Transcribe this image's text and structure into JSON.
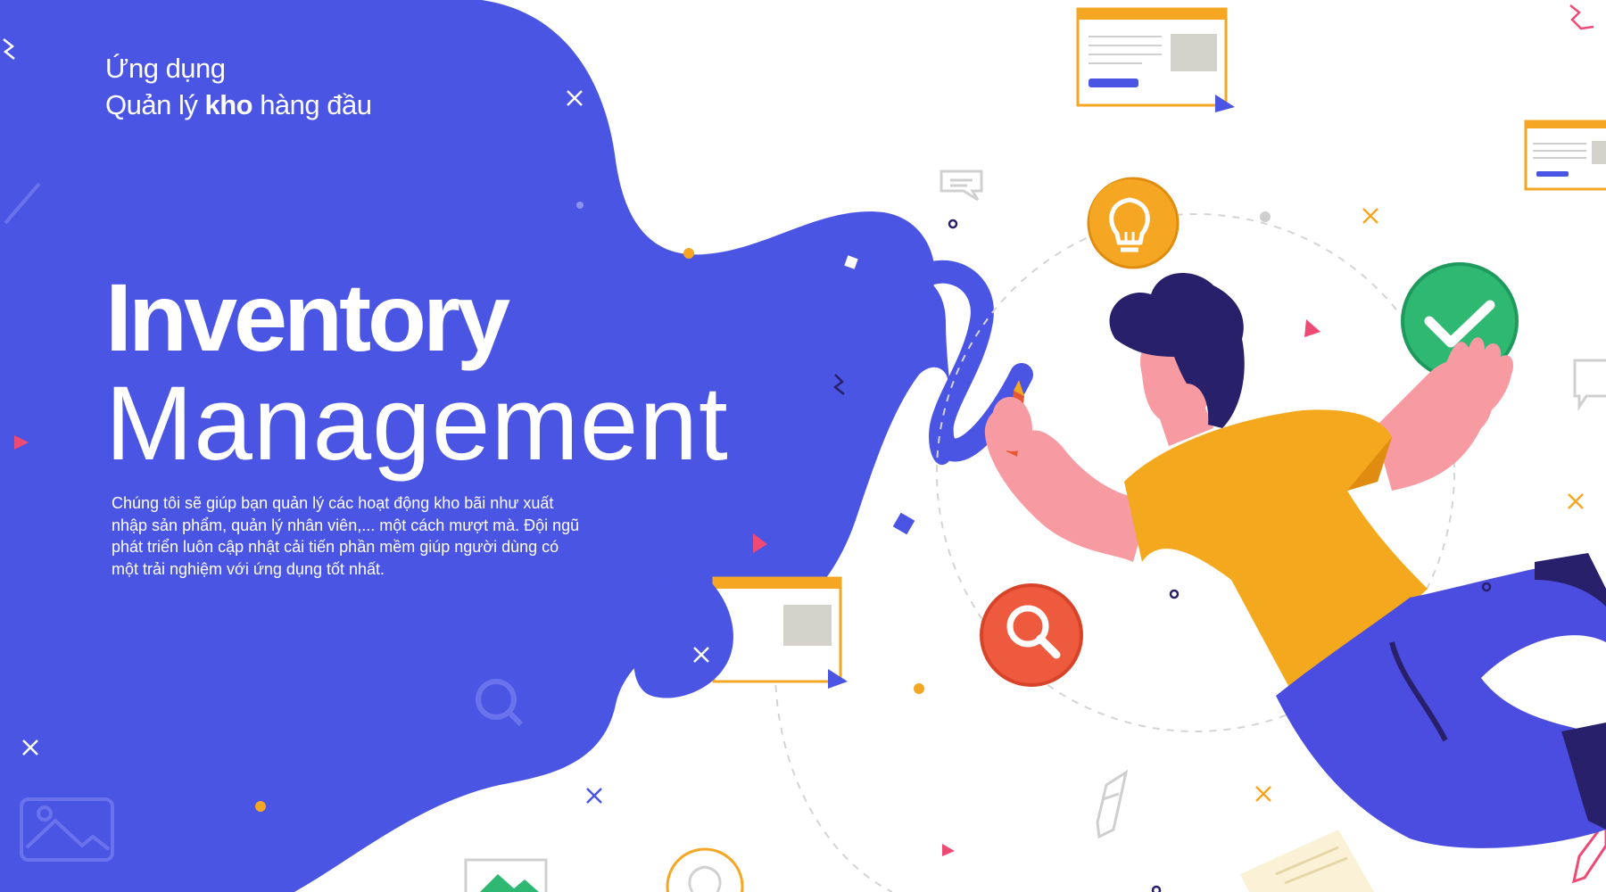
{
  "header": {
    "line1": "Ứng dụng",
    "line2_pre": "Quản lý ",
    "line2_bold": "kho",
    "line2_post": " hàng đầu"
  },
  "hero": {
    "title_bold": "Inventory",
    "title_light": "Management",
    "description": "Chúng tôi sẽ giúp bạn quản lý các hoạt động kho bãi như xuất nhập sản phẩm, quản lý nhân viên,... một cách mượt mà. Đội ngũ phát triển luôn cập nhật cải tiến phần mềm giúp người dùng có một trải nghiệm với ứng dụng tốt nhất."
  },
  "icons": {
    "lightbulb": "lightbulb-icon",
    "search": "search-icon",
    "check": "check-icon",
    "pencil": "pencil-icon",
    "image": "image-icon",
    "chat": "chat-bubble-icon"
  },
  "colors": {
    "blob": "#4b55e4",
    "navy": "#28206a",
    "shirt": "#f4a81d",
    "skin": "#f79aa1",
    "pants": "#4b4de0",
    "accent_orange": "#f5a623",
    "accent_red": "#ee5a3d",
    "accent_green": "#2eb872",
    "pink": "#ef4a75"
  }
}
